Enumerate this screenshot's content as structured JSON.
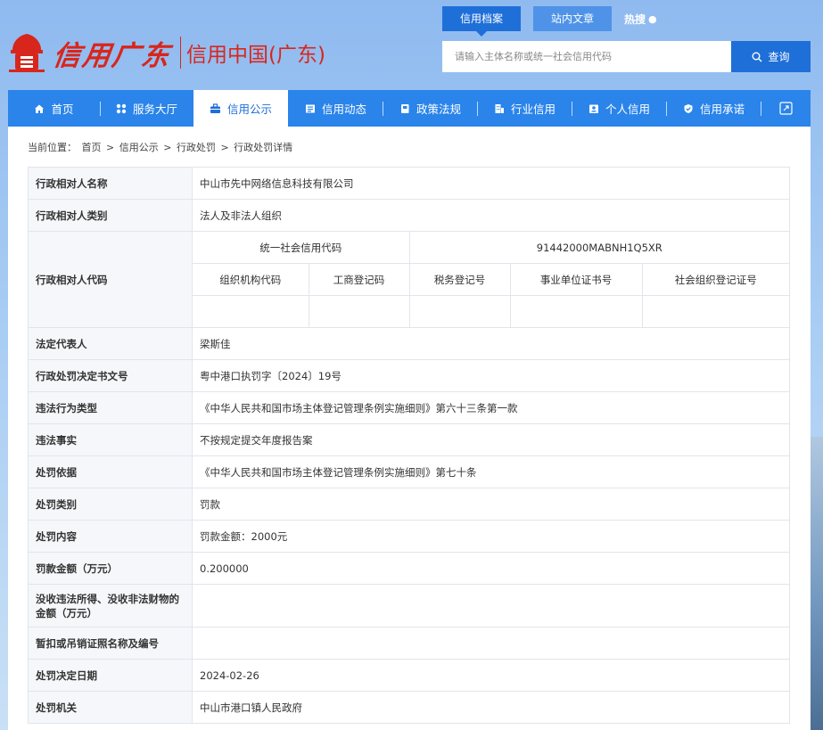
{
  "header": {
    "logo_script": "信用广东",
    "logo_cn": "信用中国(广东)",
    "top_tabs": [
      "信用档案",
      "站内文章"
    ],
    "hot_label": "热搜",
    "search": {
      "placeholder": "请输入主体名称或统一社会信用代码",
      "button": "查询"
    }
  },
  "nav": {
    "items": [
      {
        "label": "首页",
        "icon": "home-icon"
      },
      {
        "label": "服务大厅",
        "icon": "grid-icon"
      },
      {
        "label": "信用公示",
        "icon": "briefcase-icon"
      },
      {
        "label": "信用动态",
        "icon": "news-icon"
      },
      {
        "label": "政策法规",
        "icon": "book-icon"
      },
      {
        "label": "行业信用",
        "icon": "building-icon"
      },
      {
        "label": "个人信用",
        "icon": "person-card-icon"
      },
      {
        "label": "信用承诺",
        "icon": "shield-check-icon"
      }
    ],
    "active_index": 2
  },
  "breadcrumb": [
    "当前位置：",
    "首页",
    ">",
    "信用公示",
    ">",
    "行政处罚",
    ">",
    "行政处罚详情"
  ],
  "record": {
    "name_label": "行政相对人名称",
    "name_value": "中山市先中网络信息科技有限公司",
    "category_label": "行政相对人类别",
    "category_value": "法人及非法人组织",
    "code_label": "行政相对人代码",
    "uscc_label": "统一社会信用代码",
    "uscc_value": "91442000MABNH1Q5XR",
    "code_headers": [
      "组织机构代码",
      "工商登记码",
      "税务登记号",
      "事业单位证书号",
      "社会组织登记证号"
    ],
    "legal_rep_label": "法定代表人",
    "legal_rep_value": "梁斯佳",
    "doc_no_label": "行政处罚决定书文号",
    "doc_no_value": "粤中港口执罚字〔2024〕19号",
    "violation_type_label": "违法行为类型",
    "violation_type_value": "《中华人民共和国市场主体登记管理条例实施细则》第六十三条第一款",
    "facts_label": "违法事实",
    "facts_value": "不按规定提交年度报告案",
    "basis_label": "处罚依据",
    "basis_value": "《中华人民共和国市场主体登记管理条例实施细则》第七十条",
    "penalty_type_label": "处罚类别",
    "penalty_type_value": "罚款",
    "content_label": "处罚内容",
    "content_value": "罚款金额：2000元",
    "amount_label": "罚款金额（万元）",
    "amount_value": "0.200000",
    "confiscation_label": "没收违法所得、没收非法财物的金额（万元）",
    "confiscation_value": "",
    "license_label": "暂扣或吊销证照名称及编号",
    "license_value": "",
    "date_label": "处罚决定日期",
    "date_value": "2024-02-26",
    "authority_label": "处罚机关",
    "authority_value": "中山市港口镇人民政府"
  },
  "colors": {
    "brand_red": "#d8261c",
    "nav_blue": "#2a84ea",
    "active_blue": "#1f6fd8"
  }
}
